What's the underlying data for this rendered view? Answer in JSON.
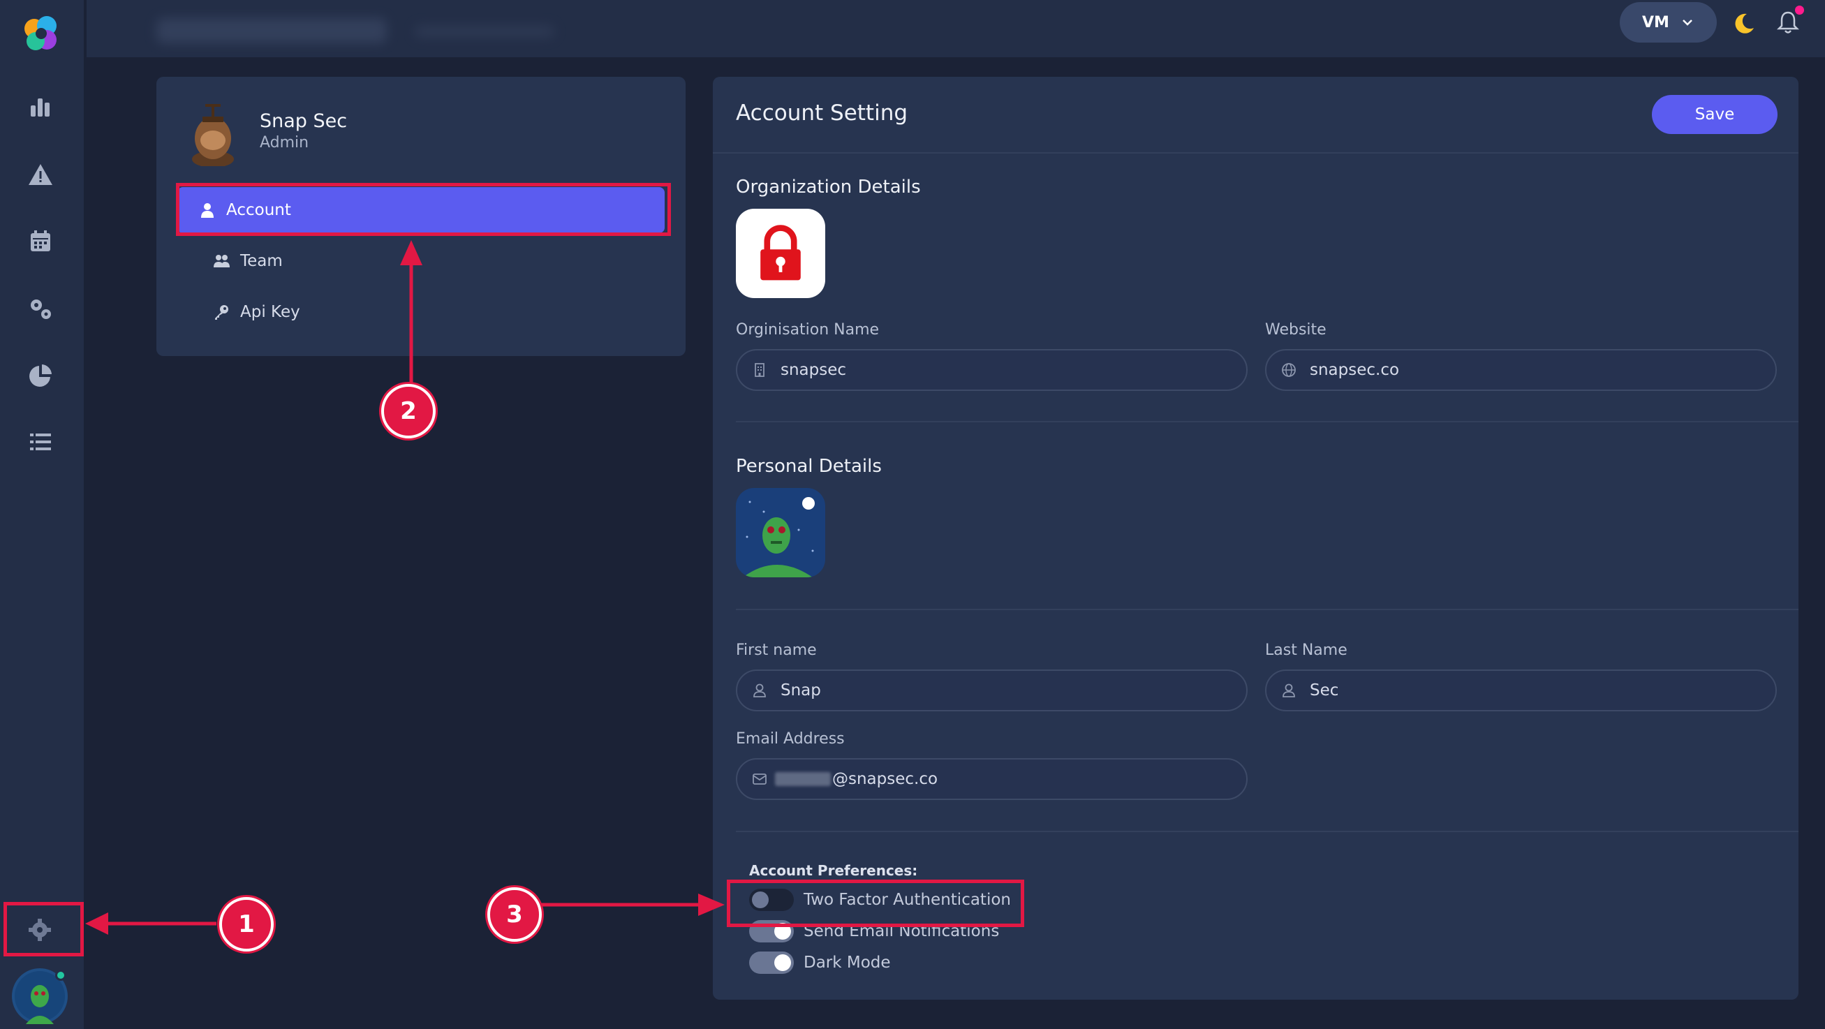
{
  "colors": {
    "accent": "#5b5cf0",
    "background": "#1b2236",
    "card": "#273450",
    "annotation": "#e21844"
  },
  "topbar": {
    "user_initials": "VM"
  },
  "sidebar": {
    "icons": [
      "analytics-icon",
      "warning-icon",
      "calendar-icon",
      "cogs-icon",
      "pie-chart-icon",
      "list-icon"
    ]
  },
  "profile": {
    "name": "Snap Sec",
    "role": "Admin",
    "menu": [
      {
        "label": "Account",
        "icon": "user-icon",
        "active": true
      },
      {
        "label": "Team",
        "icon": "users-icon",
        "active": false
      },
      {
        "label": "Api Key",
        "icon": "key-icon",
        "active": false
      }
    ]
  },
  "settings": {
    "title": "Account Setting",
    "save_label": "Save",
    "org_section_title": "Organization Details",
    "org_name_label": "Orginisation Name",
    "org_name_value": "snapsec",
    "website_label": "Website",
    "website_value": "snapsec.co",
    "personal_section_title": "Personal Details",
    "first_name_label": "First name",
    "first_name_value": "Snap",
    "last_name_label": "Last Name",
    "last_name_value": "Sec",
    "email_label": "Email Address",
    "email_value": "@snapsec.co",
    "preferences_label": "Account Preferences:",
    "preferences": [
      {
        "label": "Two Factor Authentication",
        "enabled": false
      },
      {
        "label": "Send Email Notifications",
        "enabled": true
      },
      {
        "label": "Dark Mode",
        "enabled": true
      }
    ]
  },
  "annotations": [
    "1",
    "2",
    "3"
  ]
}
